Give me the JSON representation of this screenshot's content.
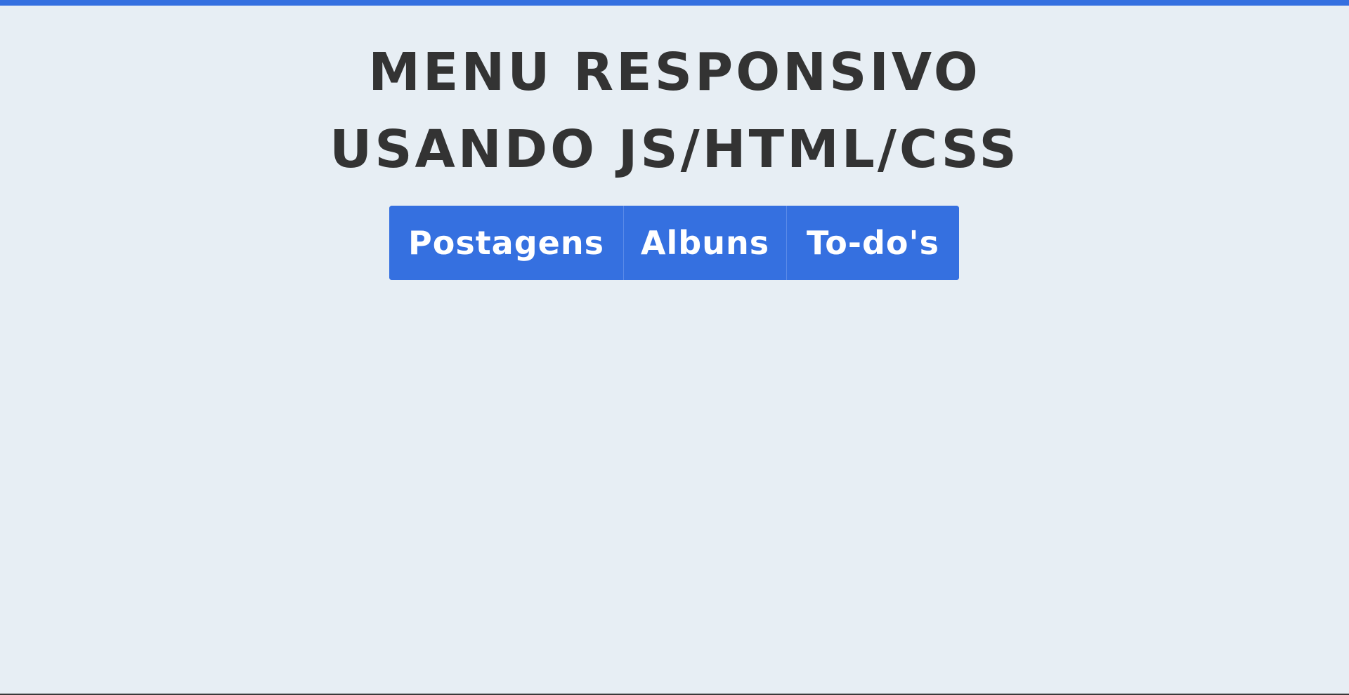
{
  "header": {
    "title_line1": "MENU RESPONSIVO",
    "title_line2": "USANDO JS/HTML/CSS"
  },
  "menu": {
    "items": [
      {
        "label": "Postagens"
      },
      {
        "label": "Albuns"
      },
      {
        "label": "To-do's"
      }
    ]
  },
  "colors": {
    "accent": "#3570e0",
    "background": "#e7eef4",
    "title_text": "#333333"
  }
}
